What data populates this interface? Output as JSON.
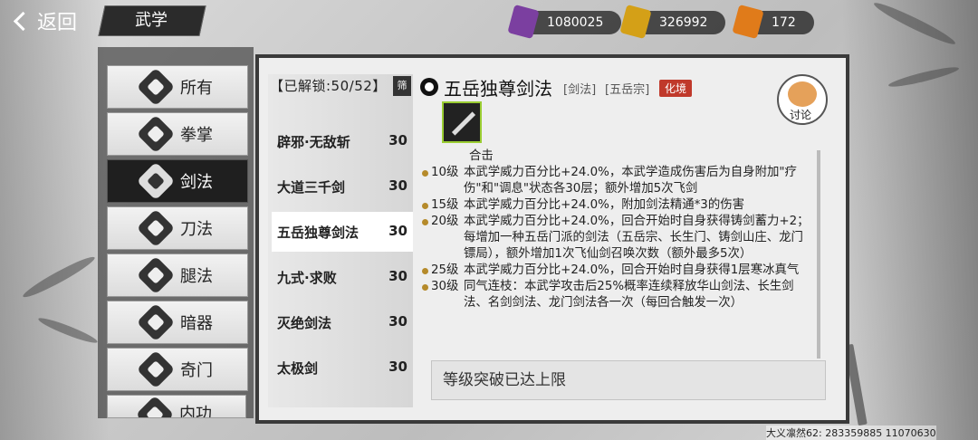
{
  "header": {
    "back_label": "返回",
    "title": "武学"
  },
  "currencies": [
    {
      "icon": "purple-token-icon",
      "value": "1080025",
      "color": "#7b3fa0"
    },
    {
      "icon": "gold-token-icon",
      "value": "326992",
      "color": "#d4a017"
    },
    {
      "icon": "fire-token-icon",
      "value": "172",
      "color": "#e07b1a"
    }
  ],
  "categories": [
    "所有",
    "拳掌",
    "剑法",
    "刀法",
    "腿法",
    "暗器",
    "奇门",
    "内功"
  ],
  "active_category": "剑法",
  "list": {
    "unlock_text": "【已解锁:50/52】",
    "filter_label": "筛",
    "skills": [
      {
        "name": "辟邪·无敌斩",
        "level": "30"
      },
      {
        "name": "大道三千剑",
        "level": "30"
      },
      {
        "name": "五岳独尊剑法",
        "level": "30"
      },
      {
        "name": "九式·求败",
        "level": "30"
      },
      {
        "name": "灭绝剑法",
        "level": "30"
      },
      {
        "name": "太极剑",
        "level": "30"
      }
    ]
  },
  "detail": {
    "title": "五岳独尊剑法",
    "tag1": "[剑法]",
    "tag2": "[五岳宗]",
    "tag_red": "化境",
    "discuss_label": "讨论",
    "top_line": "合击",
    "levels": [
      {
        "lvl": "10级",
        "text": "本武学威力百分比+24.0%，本武学造成伤害后为自身附加\"疗伤\"和\"调息\"状态各30层；额外增加5次飞剑"
      },
      {
        "lvl": "15级",
        "text": "本武学威力百分比+24.0%，附加剑法精通*3的伤害"
      },
      {
        "lvl": "20级",
        "text": "本武学威力百分比+24.0%，回合开始时自身获得铸剑蓄力+2；每增加一种五岳门派的剑法（五岳宗、长生门、铸剑山庄、龙门镖局），额外增加1次飞仙剑召唤次数（额外最多5次）"
      },
      {
        "lvl": "25级",
        "text": "本武学威力百分比+24.0%，回合开始时自身获得1层寒冰真气"
      },
      {
        "lvl": "30级",
        "text": "同气连枝：本武学攻击后25%概率连续释放华山剑法、长生剑法、名剑剑法、龙门剑法各一次（每回合触发一次）"
      }
    ],
    "limit_text": "等级突破已达上限"
  },
  "footer_text": "大义凛然62: 283359885 11070630"
}
